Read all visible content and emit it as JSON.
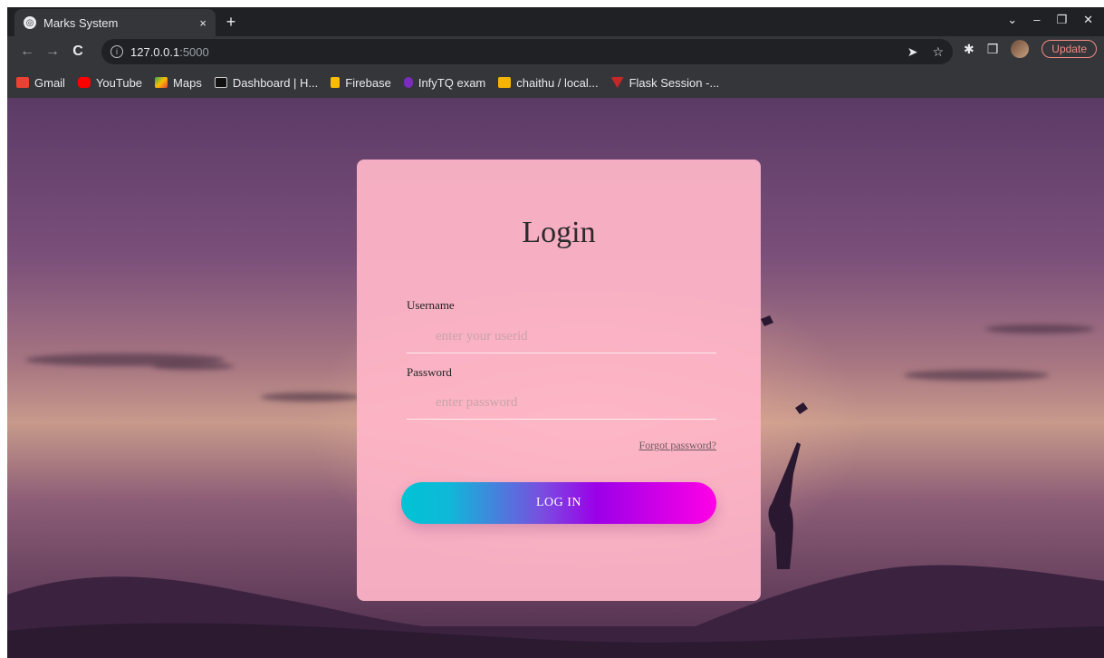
{
  "browser": {
    "tab_title": "Marks System",
    "tab_close": "×",
    "new_tab": "+",
    "window_controls": [
      "⌄",
      "–",
      "❐",
      "✕"
    ],
    "nav": {
      "back": "←",
      "forward": "→",
      "reload": "C"
    },
    "url_host": "127.0.0.1",
    "url_port": ":5000",
    "omni_icons": [
      "➤",
      "☆"
    ],
    "toolbar_icons": [
      "✱",
      "❒"
    ],
    "update_label": "Update"
  },
  "bookmarks": [
    {
      "label": "Gmail",
      "color": "#ea4335"
    },
    {
      "label": "YouTube",
      "color": "#ff0000"
    },
    {
      "label": "Maps",
      "color": "#34a853"
    },
    {
      "label": "Dashboard | H...",
      "color": "#111111"
    },
    {
      "label": "Firebase",
      "color": "#fbbc04"
    },
    {
      "label": "InfyTQ exam",
      "color": "#7b2cbf"
    },
    {
      "label": "chaithu / local...",
      "color": "#f4b400"
    },
    {
      "label": "Flask Session -...",
      "color": "#c62828"
    }
  ],
  "login": {
    "title": "Login",
    "username_label": "Username",
    "username_placeholder": "enter your userid",
    "password_label": "Password",
    "password_placeholder": "enter password",
    "forgot_label": "Forgot password?",
    "submit_label": "LOG IN"
  },
  "colors": {
    "card_bg": "#ffb6c8",
    "button_start": "#00c4d4",
    "button_mid": "#9b00e8",
    "button_end": "#ff00e6"
  }
}
